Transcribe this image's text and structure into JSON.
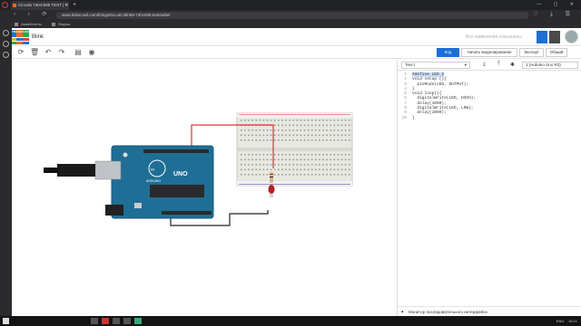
{
  "browser": {
    "tab_title": "Circuits 74HC595 TEST | Ti",
    "tab_close": "×",
    "new_tab": "+",
    "url": "www.tinkercad.com/things/5cLutC4kh59-74hc595-test/editel",
    "bookmarks": [
      "Авиабилеты",
      "Яндекс"
    ]
  },
  "app": {
    "project_title": "Blink",
    "saved_status": "Все изменения сохранены",
    "logo_letters": [
      "TIN",
      "KER",
      "CAD",
      "",
      "",
      "",
      "",
      "",
      ""
    ],
    "logo_colors": [
      "#1477d4",
      "#f26c22",
      "#2ba84a",
      "#e8b80d",
      "#1477d4",
      "#e63946",
      "#2ba84a",
      "#f26c22",
      "#1477d4"
    ]
  },
  "toolbar": {
    "code_label": "Код",
    "simulate_label": "Начать моделирование",
    "export_label": "Экспорт",
    "share_label": "Общий"
  },
  "code_panel": {
    "mode": "Текст",
    "board": "1 (Arduino Uno R3)",
    "lines": [
      "#define LED 2",
      "void setup (){",
      "  pinMode(LED, OUTPUT);",
      "}",
      "void loop(){",
      "  digitalWrite(LED, HIGH);",
      "  delay(1000);",
      "  digitalWrite(LED, LOW);",
      "  delay(1000);",
      "}"
    ],
    "serial_label": "Монитор последовательного интерфейса"
  },
  "board": {
    "brand": "ARDUINO",
    "model": "UNO"
  },
  "taskbar": {
    "lang": "ENG",
    "time": "18:21"
  }
}
